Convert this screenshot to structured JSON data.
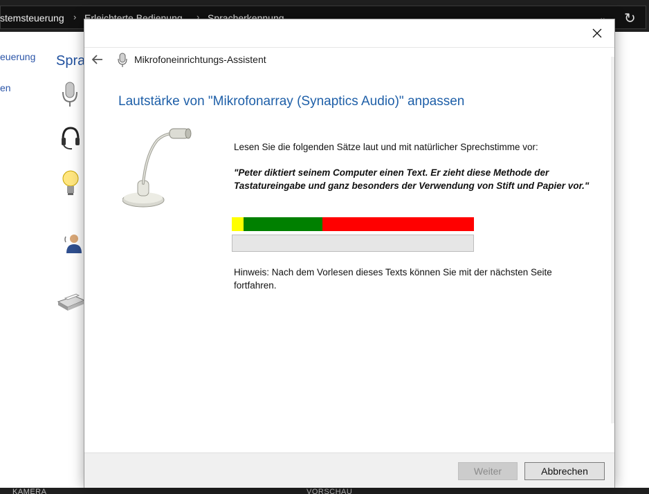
{
  "background": {
    "breadcrumbs": [
      "stemsteuerung",
      "Erleichterte Bedienung",
      "Spracherkennung"
    ],
    "sidebar_items": [
      "euerung",
      "en"
    ],
    "heading": "Spra",
    "bottom_labels": [
      "KAMERA",
      "VORSCHAU"
    ]
  },
  "dialog": {
    "wizard_title": "Mikrofoneinrichtungs-Assistent",
    "heading": "Lautstärke von \"Mikrofonarray (Synaptics Audio)\" anpassen",
    "instruction": "Lesen Sie die folgenden Sätze laut und mit natürlicher Sprechstimme vor:",
    "quote": "\"Peter diktiert seinem Computer einen Text. Er zieht diese Methode der Tastatureingabe und ganz besonders der Verwendung von Stift und Papier vor.\"",
    "level_meter": {
      "colors": [
        "#ffff00",
        "#008000",
        "#ff0000"
      ]
    },
    "progress": {
      "value": 0
    },
    "hint": "Hinweis: Nach dem Vorlesen dieses Texts können Sie mit der nächsten Seite fortfahren.",
    "buttons": {
      "next": "Weiter",
      "cancel": "Abbrechen"
    }
  }
}
